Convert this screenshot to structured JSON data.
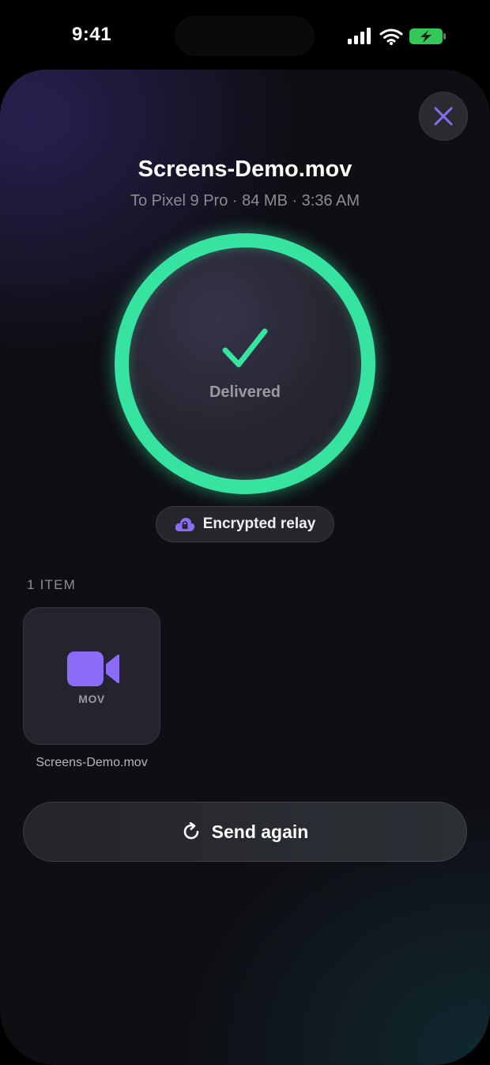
{
  "status_bar": {
    "time": "9:41"
  },
  "sheet": {
    "title": "Screens-Demo.mov",
    "subtitle": "To Pixel 9 Pro · 84 MB · 3:36 AM",
    "progress_ring": {
      "status_label": "Delivered",
      "progress": 1.0,
      "color": "#36e3a0"
    },
    "relay_badge": {
      "label": "Encrypted relay",
      "icon": "lock-cloud-icon",
      "icon_color": "#8b6cf6"
    },
    "items_section": {
      "label": "1 ITEM",
      "items": [
        {
          "type_label": "MOV",
          "name": "Screens-Demo.mov",
          "icon": "video-camera-icon",
          "icon_color": "#8b6cf6"
        }
      ]
    },
    "send_again_button": {
      "label": "Send again",
      "icon": "refresh-icon"
    },
    "close_button": {
      "icon": "close-icon",
      "icon_color": "#8b6cf6"
    }
  }
}
